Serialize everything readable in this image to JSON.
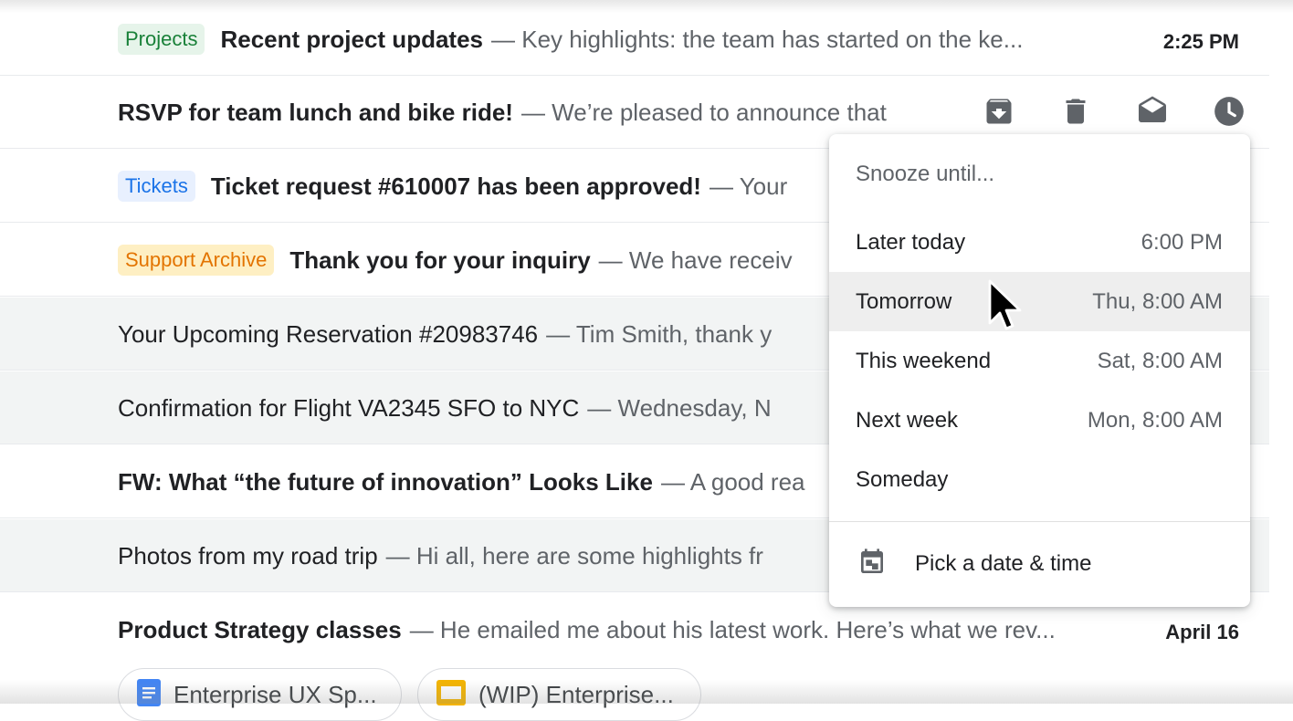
{
  "colors": {
    "label_projects_bg": "#e6f4ea",
    "label_projects_fg": "#188038",
    "label_tickets_bg": "#e8f0fe",
    "label_tickets_fg": "#1a73e8",
    "label_support_bg": "#feefc3",
    "label_support_fg": "#e37400",
    "icon_gray": "#5f6368",
    "doc_blue": "#4285f4",
    "slides_yellow": "#f4b400"
  },
  "emails": [
    {
      "label": "Projects",
      "subject": "Recent project updates",
      "snippet": "— Key highlights: the team has started on the ke...",
      "date": "2:25 PM"
    },
    {
      "subject": "RSVP for team lunch and bike ride!",
      "snippet": "— We’re pleased to announce that"
    },
    {
      "label": "Tickets",
      "subject": "Ticket request #610007 has been approved!",
      "snippet": "— Your"
    },
    {
      "label": "Support Archive",
      "subject": "Thank you for your inquiry",
      "snippet": "— We have receiv"
    },
    {
      "subject": "Your Upcoming Reservation #20983746",
      "snippet": "— Tim Smith, thank y"
    },
    {
      "subject": "Confirmation for Flight VA2345 SFO to NYC",
      "snippet": "— Wednesday, N"
    },
    {
      "subject": "FW: What “the future of innovation” Looks Like",
      "snippet": "— A good rea"
    },
    {
      "subject": "Photos from my road trip",
      "snippet": "— Hi all, here are some highlights fr"
    },
    {
      "subject": "Product Strategy classes",
      "snippet": "— He emailed me about his latest work. Here’s what we rev...",
      "date": "April 16"
    }
  ],
  "row_actions": [
    "archive-icon",
    "delete-icon",
    "mark-as-read-icon",
    "snooze-icon"
  ],
  "attachments": [
    {
      "icon": "docs-icon",
      "name": "Enterprise UX Sp..."
    },
    {
      "icon": "slides-icon",
      "name": "(WIP) Enterprise..."
    }
  ],
  "snooze_menu": {
    "title": "Snooze until...",
    "options": [
      {
        "label": "Later today",
        "time": "6:00 PM"
      },
      {
        "label": "Tomorrow",
        "time": "Thu, 8:00 AM"
      },
      {
        "label": "This weekend",
        "time": "Sat, 8:00 AM"
      },
      {
        "label": "Next week",
        "time": "Mon, 8:00 AM"
      },
      {
        "label": "Someday",
        "time": ""
      }
    ],
    "pick_label": "Pick a date & time",
    "pick_icon": "calendar-icon"
  }
}
